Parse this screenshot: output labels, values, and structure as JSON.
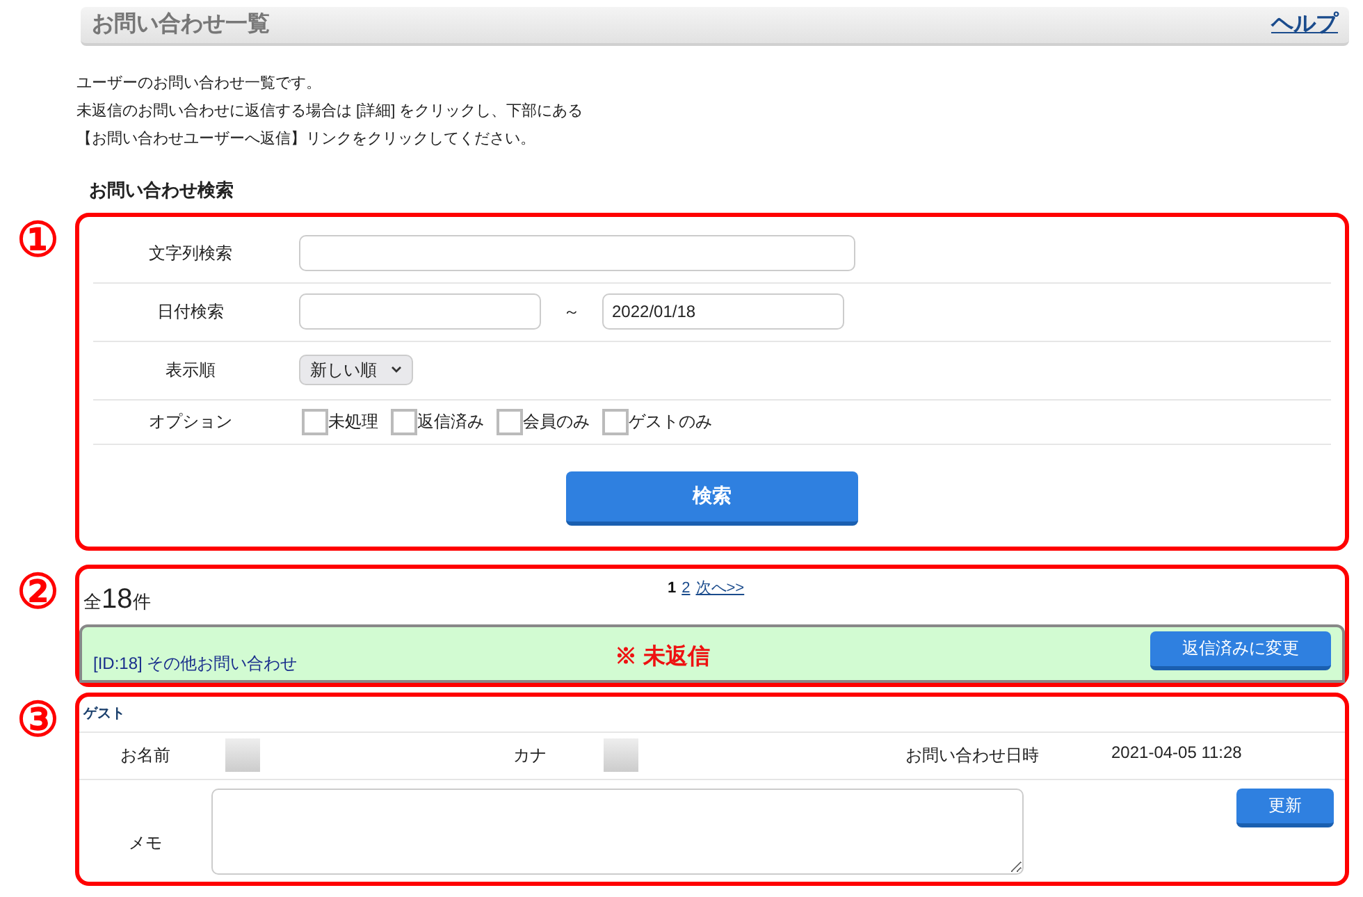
{
  "header": {
    "title": "お問い合わせ一覧",
    "help_link": "ヘルプ"
  },
  "description": [
    "ユーザーのお問い合わせ一覧です。",
    "未返信のお問い合わせに返信する場合は [詳細] をクリックし、下部にある",
    "【お問い合わせユーザーへ返信】リンクをクリックしてください。"
  ],
  "search_section": {
    "title": "お問い合わせ検索",
    "marker": "①",
    "fields": [
      {
        "kind": "text",
        "label": "文字列検索"
      },
      {
        "kind": "date_range",
        "label": "日付検索",
        "separator": "～",
        "to_value": "2022/01/18"
      },
      {
        "kind": "select",
        "label": "表示順",
        "value": "新しい順"
      },
      {
        "kind": "checkboxes",
        "label": "オプション",
        "options": [
          {
            "label": "未処理",
            "checked": false
          },
          {
            "label": "返信済み",
            "checked": false
          },
          {
            "label": "会員のみ",
            "checked": false
          },
          {
            "label": "ゲストのみ",
            "checked": false
          }
        ]
      }
    ],
    "search_button": "検索"
  },
  "results": {
    "marker": "②",
    "total_prefix": "全",
    "total_count": "18",
    "total_suffix": "件",
    "pages": [
      {
        "label": "1",
        "selected": true
      },
      {
        "label": "2",
        "selected": false
      }
    ],
    "next_link": "次へ>>",
    "inquiry": {
      "title": "[ID:18] その他お問い合わせ",
      "status": "※ 未返信",
      "status_button": "返信済みに変更"
    }
  },
  "detail": {
    "marker": "③",
    "user_type": "ゲスト",
    "name_label": "お名前",
    "kana_label": "カナ",
    "date_label": "お問い合わせ日時",
    "date_value": "2021-04-05 11:28",
    "memo_label": "メモ",
    "update_button": "更新"
  }
}
